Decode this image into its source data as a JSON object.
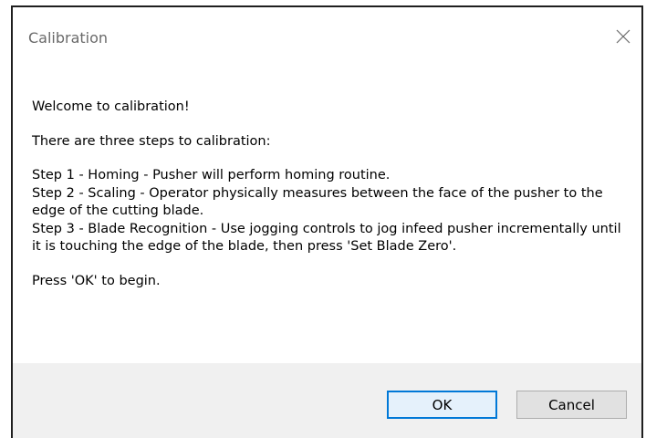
{
  "window": {
    "title": "Calibration"
  },
  "message": {
    "welcome": "Welcome to calibration!",
    "intro": "There are three steps to calibration:",
    "steps": [
      "Step 1 - Homing - Pusher will perform homing routine.",
      "Step 2 - Scaling - Operator physically measures between the face of the pusher to the edge of the cutting blade.",
      "Step 3 - Blade Recognition - Use jogging controls to jog infeed pusher incrementally until it is touching the edge of the blade, then press 'Set Blade Zero'."
    ],
    "prompt": "Press 'OK' to begin."
  },
  "buttons": {
    "ok_label": "OK",
    "cancel_label": "Cancel"
  },
  "icons": {
    "close": "close-icon"
  },
  "colors": {
    "footer_bg": "#f0f0f0",
    "default_button_border": "#0078d7",
    "title_text": "#6a6a6a"
  }
}
